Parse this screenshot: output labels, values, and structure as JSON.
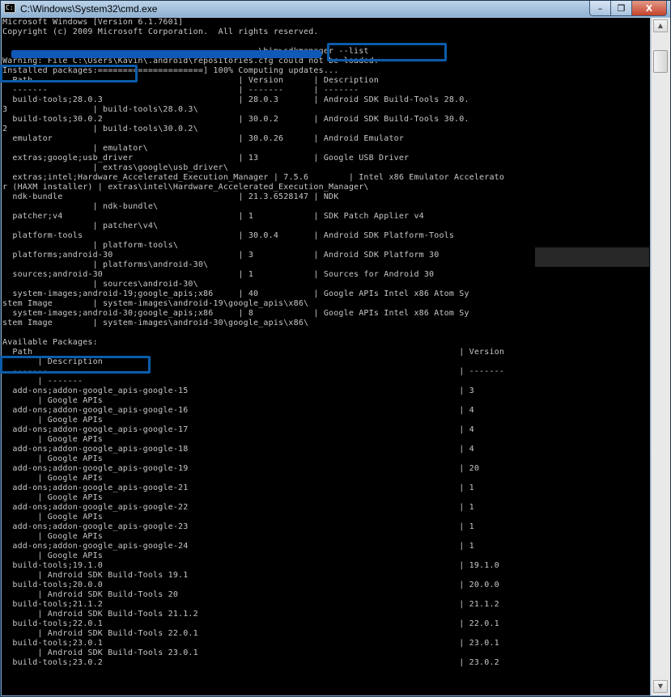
{
  "window": {
    "title": "C:\\Windows\\System32\\cmd.exe",
    "minimize": "–",
    "restore": "❐",
    "close": "X"
  },
  "console": {
    "lines": [
      "Microsoft Windows [Version 6.1.7601]",
      "Copyright (c) 2009 Microsoft Corporation.  All rights reserved.",
      "",
      "                                                   \\bin>sdkmanager --list",
      "Warning: File C:\\Users\\Kavin\\.android\\repositories.cfg could not be loaded.",
      "Installed packages:=====================] 100% Computing updates...",
      "  Path                                         | Version      | Description",
      "  -------                                      | -------      | -------",
      "  build-tools;28.0.3                           | 28.0.3       | Android SDK Build-Tools 28.0.",
      "3                 | build-tools\\28.0.3\\",
      "  build-tools;30.0.2                           | 30.0.2       | Android SDK Build-Tools 30.0.",
      "2                 | build-tools\\30.0.2\\",
      "  emulator                                     | 30.0.26      | Android Emulator",
      "                  | emulator\\",
      "  extras;google;usb_driver                     | 13           | Google USB Driver",
      "                  | extras\\google\\usb_driver\\",
      "  extras;intel;Hardware_Accelerated_Execution_Manager | 7.5.6        | Intel x86 Emulator Accelerato",
      "r (HAXM installer) | extras\\intel\\Hardware_Accelerated_Execution_Manager\\",
      "  ndk-bundle                                   | 21.3.6528147 | NDK",
      "                  | ndk-bundle\\",
      "  patcher;v4                                   | 1            | SDK Patch Applier v4",
      "                  | patcher\\v4\\",
      "  platform-tools                               | 30.0.4       | Android SDK Platform-Tools",
      "                  | platform-tools\\",
      "  platforms;android-30                         | 3            | Android SDK Platform 30",
      "                  | platforms\\android-30\\",
      "  sources;android-30                           | 1            | Sources for Android 30",
      "                  | sources\\android-30\\",
      "  system-images;android-19;google_apis;x86     | 40           | Google APIs Intel x86 Atom Sy",
      "stem Image        | system-images\\android-19\\google_apis\\x86\\",
      "  system-images;android-30;google_apis;x86     | 8            | Google APIs Intel x86 Atom Sy",
      "stem Image        | system-images\\android-30\\google_apis\\x86\\",
      "",
      "Available Packages:",
      "  Path                                                                                     | Version",
      "       | Description",
      "  -------                                                                                  | -------",
      "       | -------",
      "  add-ons;addon-google_apis-google-15                                                      | 3",
      "       | Google APIs",
      "  add-ons;addon-google_apis-google-16                                                      | 4",
      "       | Google APIs",
      "  add-ons;addon-google_apis-google-17                                                      | 4",
      "       | Google APIs",
      "  add-ons;addon-google_apis-google-18                                                      | 4",
      "       | Google APIs",
      "  add-ons;addon-google_apis-google-19                                                      | 20",
      "       | Google APIs",
      "  add-ons;addon-google_apis-google-21                                                      | 1",
      "       | Google APIs",
      "  add-ons;addon-google_apis-google-22                                                      | 1",
      "       | Google APIs",
      "  add-ons;addon-google_apis-google-23                                                      | 1",
      "       | Google APIs",
      "  add-ons;addon-google_apis-google-24                                                      | 1",
      "       | Google APIs",
      "  build-tools;19.1.0                                                                       | 19.1.0",
      "       | Android SDK Build-Tools 19.1",
      "  build-tools;20.0.0                                                                       | 20.0.0",
      "       | Android SDK Build-Tools 20",
      "  build-tools;21.1.2                                                                       | 21.1.2",
      "       | Android SDK Build-Tools 21.1.2",
      "  build-tools;22.0.1                                                                       | 22.0.1",
      "       | Android SDK Build-Tools 22.0.1",
      "  build-tools;23.0.1                                                                       | 23.0.1",
      "       | Android SDK Build-Tools 23.0.1",
      "  build-tools;23.0.2                                                                       | 23.0.2"
    ]
  },
  "scrollbar": {
    "up": "▲",
    "down": "▼"
  },
  "colors": {
    "text": "#c8c8c8",
    "background": "#000000",
    "highlight": "#0c5cab"
  }
}
